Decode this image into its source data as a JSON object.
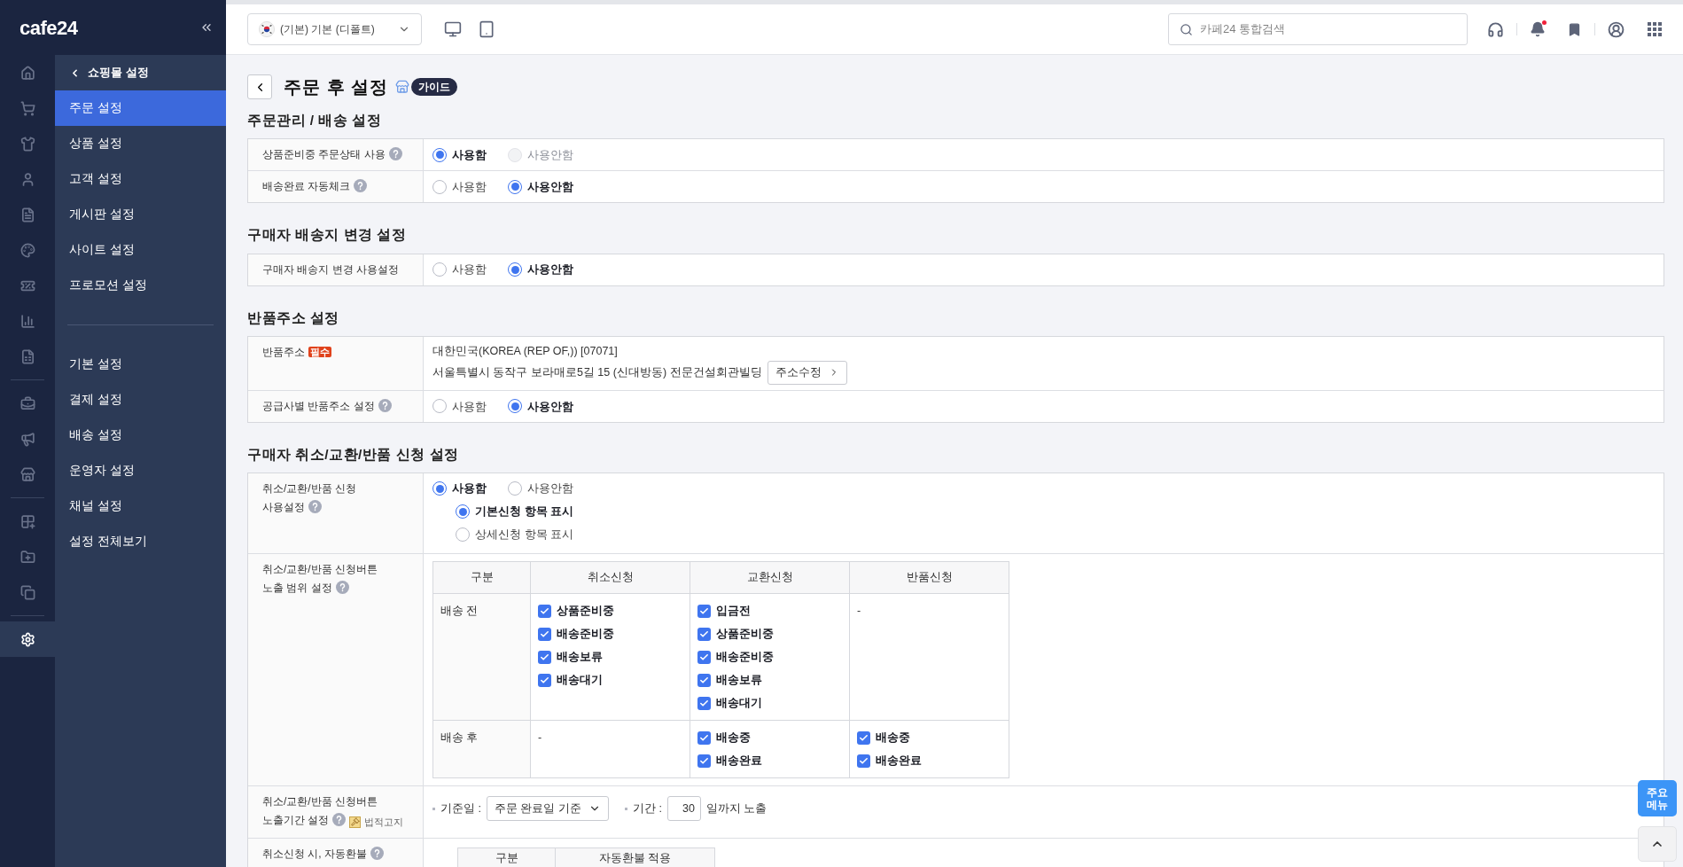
{
  "logo": "cafe24",
  "rail": [
    [
      {
        "selected": false
      },
      {
        "selected": false
      },
      {
        "selected": false
      },
      {
        "selected": false
      },
      {
        "selected": false
      },
      {
        "selected": false
      },
      {
        "selected": false
      },
      {
        "selected": false
      },
      {
        "selected": false
      }
    ],
    [
      {
        "selected": false
      },
      {
        "selected": false
      },
      {
        "selected": false
      }
    ],
    [
      {
        "selected": false
      },
      {
        "selected": false
      },
      {
        "selected": false
      }
    ],
    [
      {
        "selected": true
      }
    ]
  ],
  "submenu": {
    "back": "쇼핑몰 설정",
    "groups": [
      [
        {
          "label": "주문 설정",
          "selected": true
        },
        {
          "label": "상품 설정",
          "selected": false
        },
        {
          "label": "고객 설정",
          "selected": false
        },
        {
          "label": "게시판 설정",
          "selected": false
        },
        {
          "label": "사이트 설정",
          "selected": false
        },
        {
          "label": "프로모션 설정",
          "selected": false
        }
      ],
      [
        {
          "label": "기본 설정",
          "selected": false
        },
        {
          "label": "결제 설정",
          "selected": false
        },
        {
          "label": "배송 설정",
          "selected": false
        },
        {
          "label": "운영자 설정",
          "selected": false
        },
        {
          "label": "채널 설정",
          "selected": false
        },
        {
          "label": "설정 전체보기",
          "selected": false
        }
      ]
    ]
  },
  "header": {
    "store": "(기본) 기본 (디폴트)",
    "search_placeholder": "카페24 통합검색",
    "has_notification": true
  },
  "page": {
    "title": "주문 후 설정",
    "guide": "가이드"
  },
  "sections": [
    {
      "title": "주문관리 / 배송 설정",
      "rows": [
        {
          "kind": "radio",
          "label": [
            "상품준비중 주문상태 사용"
          ],
          "help": true,
          "options": [
            {
              "label": "사용함",
              "selected": true,
              "disabled": false
            },
            {
              "label": "사용안함",
              "selected": false,
              "disabled": true
            }
          ]
        },
        {
          "kind": "radio",
          "label": [
            "배송완료 자동체크"
          ],
          "help": true,
          "options": [
            {
              "label": "사용함",
              "selected": false,
              "disabled": false
            },
            {
              "label": "사용안함",
              "selected": true,
              "disabled": false
            }
          ]
        }
      ]
    },
    {
      "title": "구매자 배송지 변경 설정",
      "rows": [
        {
          "kind": "radio",
          "label": [
            "구매자 배송지 변경 사용설정"
          ],
          "help": false,
          "options": [
            {
              "label": "사용함",
              "selected": false,
              "disabled": false
            },
            {
              "label": "사용안함",
              "selected": true,
              "disabled": false
            }
          ]
        }
      ]
    },
    {
      "title": "반품주소 설정",
      "rows": [
        {
          "kind": "address",
          "label": [
            "반품주소"
          ],
          "help": false,
          "required": "필수",
          "lines": [
            "대한민국(KOREA (REP OF,)) [07071]",
            "서울특별시 동작구 보라매로5길 15 (신대방동) 전문건설회관빌딩"
          ],
          "button": "주소수정"
        },
        {
          "kind": "radio",
          "label": [
            "공급사별 반품주소 설정"
          ],
          "help": true,
          "options": [
            {
              "label": "사용함",
              "selected": false,
              "disabled": false
            },
            {
              "label": "사용안함",
              "selected": true,
              "disabled": false
            }
          ]
        }
      ]
    },
    {
      "title": "구매자 취소/교환/반품 신청 설정",
      "rows": [
        {
          "kind": "radio_nested",
          "label": [
            "취소/교환/반품 신청",
            "사용설정"
          ],
          "help": true,
          "options": [
            {
              "label": "사용함",
              "selected": true,
              "disabled": false
            },
            {
              "label": "사용안함",
              "selected": false,
              "disabled": false
            }
          ],
          "sub_options": [
            {
              "label": "기본신청 항목 표시",
              "selected": true
            },
            {
              "label": "상세신청 항목 표시",
              "selected": false
            }
          ]
        },
        {
          "kind": "matrix",
          "label": [
            "취소/교환/반품 신청버튼",
            "노출 범위 설정"
          ],
          "help": true,
          "columns": [
            "구분",
            "취소신청",
            "교환신청",
            "반품신청"
          ],
          "rows": [
            {
              "cells": [
                {
                  "text": "배송 전"
                },
                {
                  "items": [
                    {
                      "label": "상품준비중",
                      "checked": true
                    },
                    {
                      "label": "배송준비중",
                      "checked": true
                    },
                    {
                      "label": "배송보류",
                      "checked": true
                    },
                    {
                      "label": "배송대기",
                      "checked": true
                    }
                  ]
                },
                {
                  "items": [
                    {
                      "label": "입금전",
                      "checked": true
                    },
                    {
                      "label": "상품준비중",
                      "checked": true
                    },
                    {
                      "label": "배송준비중",
                      "checked": true
                    },
                    {
                      "label": "배송보류",
                      "checked": true
                    },
                    {
                      "label": "배송대기",
                      "checked": true
                    }
                  ]
                },
                {
                  "text": "-"
                }
              ]
            },
            {
              "cells": [
                {
                  "text": "배송 후"
                },
                {
                  "text": "-"
                },
                {
                  "items": [
                    {
                      "label": "배송중",
                      "checked": true
                    },
                    {
                      "label": "배송완료",
                      "checked": true
                    }
                  ]
                },
                {
                  "items": [
                    {
                      "label": "배송중",
                      "checked": true
                    },
                    {
                      "label": "배송완료",
                      "checked": true
                    }
                  ]
                }
              ]
            }
          ]
        },
        {
          "kind": "period",
          "label": [
            "취소/교환/반품 신청버튼",
            "노출기간 설정"
          ],
          "help": true,
          "legal": "법적고지",
          "base_label": "기준일 :",
          "base_value": "주문 완료일 기준",
          "period_label": "기간 :",
          "days": "30",
          "suffix": "일까지 노출"
        },
        {
          "kind": "refund",
          "label": [
            "취소신청 시, 자동환불"
          ],
          "help": true,
          "columns": [
            "구분",
            "자동환불 적용"
          ]
        }
      ]
    }
  ],
  "floating": {
    "main_menu": "주요 메뉴"
  }
}
